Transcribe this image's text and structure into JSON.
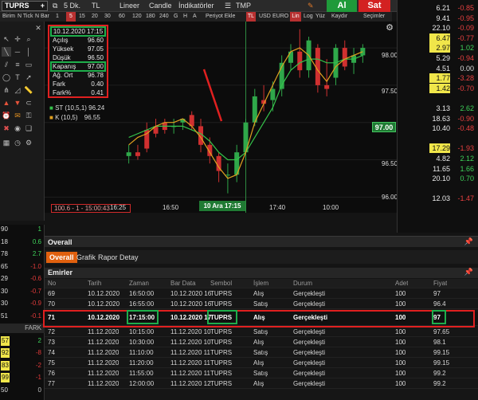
{
  "toolbar": {
    "symbol": "TUPRS",
    "period": "5 Dk.",
    "tl": "TL",
    "scale": "Lineer",
    "chart_type": "Candle",
    "indicators": "İndikatörler",
    "template": "TMP",
    "buy_label": "Al",
    "sell_label": "Sat"
  },
  "toolbar2": {
    "items": [
      "Birim",
      "N Tick",
      "N Bar",
      "1",
      "5",
      "15",
      "20",
      "30",
      "60",
      "120",
      "180",
      "240",
      "G",
      "H",
      "A",
      "Periyot Ekle",
      "TL",
      "USD",
      "EURO",
      "Lin",
      "Log",
      "Yüz",
      "Kaydır",
      "Seçimler"
    ]
  },
  "info": {
    "datetime": "10.12.2020 17:15",
    "rows": [
      {
        "label": "Açılış",
        "value": "96.60"
      },
      {
        "label": "Yüksek",
        "value": "97.05"
      },
      {
        "label": "Düşük",
        "value": "96.50"
      },
      {
        "label": "Kapanış",
        "value": "97.00"
      },
      {
        "label": "Ağ. Ort",
        "value": "96.78"
      },
      {
        "label": "Fark",
        "value": "0.40"
      },
      {
        "label": "Fark%",
        "value": "0.41"
      }
    ]
  },
  "legend": {
    "st": "ST (10,5,1) 96.24",
    "k": "K (10,5)",
    "k_value": "96.55"
  },
  "chart_axis": {
    "prices": [
      "98.00",
      "97.50",
      "97.00",
      "96.50",
      "96.00"
    ],
    "current_price": "97.00",
    "times": [
      "16:25",
      "16:50",
      "10 Ara 17:15",
      "17:40",
      "10:00"
    ],
    "bottom_left": "100.6 - 1 - 15:00:43"
  },
  "chart_data": {
    "type": "candlestick",
    "ylim": [
      95.95,
      98.3
    ],
    "candles": [
      {
        "o": 96.55,
        "h": 96.7,
        "l": 96.45,
        "c": 96.6
      },
      {
        "o": 96.6,
        "h": 96.7,
        "l": 96.5,
        "c": 96.55
      },
      {
        "o": 96.9,
        "h": 97.0,
        "l": 96.6,
        "c": 96.65
      },
      {
        "o": 96.95,
        "h": 97.05,
        "l": 96.8,
        "c": 96.85
      },
      {
        "o": 97.0,
        "h": 97.05,
        "l": 96.85,
        "c": 96.9
      },
      {
        "o": 96.95,
        "h": 97.05,
        "l": 96.85,
        "c": 96.95
      },
      {
        "o": 97.0,
        "h": 97.05,
        "l": 96.9,
        "c": 97.05
      },
      {
        "o": 97.1,
        "h": 97.15,
        "l": 96.9,
        "c": 96.95
      },
      {
        "o": 96.95,
        "h": 97.05,
        "l": 96.6,
        "c": 96.7
      },
      {
        "o": 96.7,
        "h": 96.8,
        "l": 96.45,
        "c": 96.55
      },
      {
        "o": 96.55,
        "h": 96.6,
        "l": 96.2,
        "c": 96.35
      },
      {
        "o": 96.3,
        "h": 96.45,
        "l": 96.05,
        "c": 96.3
      },
      {
        "o": 96.3,
        "h": 96.7,
        "l": 96.2,
        "c": 96.6
      },
      {
        "o": 96.6,
        "h": 97.05,
        "l": 96.5,
        "c": 97.0
      },
      {
        "o": 97.0,
        "h": 97.45,
        "l": 96.95,
        "c": 97.35
      },
      {
        "o": 97.3,
        "h": 97.5,
        "l": 97.15,
        "c": 97.25
      },
      {
        "o": 97.3,
        "h": 97.55,
        "l": 97.15,
        "c": 97.45
      },
      {
        "o": 97.45,
        "h": 97.9,
        "l": 97.35,
        "c": 97.8
      },
      {
        "o": 97.8,
        "h": 98.05,
        "l": 97.7,
        "c": 97.95
      },
      {
        "o": 97.95,
        "h": 98.25,
        "l": 97.6,
        "c": 97.7
      },
      {
        "o": 97.7,
        "h": 98.15,
        "l": 97.6,
        "c": 98.1
      },
      {
        "o": 98.0,
        "h": 98.05,
        "l": 97.4,
        "c": 97.5
      },
      {
        "o": 97.5,
        "h": 97.85,
        "l": 97.35,
        "c": 97.45
      },
      {
        "o": 97.6,
        "h": 98.05,
        "l": 97.5,
        "c": 98.0
      },
      {
        "o": 98.0,
        "h": 98.1,
        "l": 97.7,
        "c": 97.75
      },
      {
        "o": 97.8,
        "h": 98.0,
        "l": 97.65,
        "c": 97.9
      },
      {
        "o": 97.9,
        "h": 98.05,
        "l": 97.8,
        "c": 98.0
      }
    ],
    "st_line": [
      96.8,
      96.85,
      96.9,
      96.95,
      96.95,
      96.95,
      96.95,
      96.9,
      96.85,
      96.75,
      96.6,
      96.5,
      96.5,
      96.6,
      96.8,
      97.0,
      97.2,
      97.5,
      97.7,
      97.8,
      97.85,
      97.85,
      97.8,
      97.8,
      97.85,
      97.85,
      97.9
    ],
    "k_line": [
      96.7,
      96.8,
      96.85,
      96.95,
      97.0,
      97.0,
      97.05,
      96.95,
      96.8,
      96.6,
      96.4,
      96.25,
      96.3,
      96.6,
      97.0,
      97.25,
      97.5,
      97.75,
      97.95,
      98.0,
      97.9,
      97.7,
      97.55,
      97.75,
      97.85,
      97.9,
      97.95
    ]
  },
  "watchlist": [
    {
      "price": "6.21",
      "change": "-0.85",
      "bg": ""
    },
    {
      "price": "9.41",
      "change": "-0.95",
      "bg": ""
    },
    {
      "price": "22.10",
      "change": "-0.09",
      "bg": ""
    },
    {
      "price": "6.47",
      "change": "-0.77",
      "bg": "#f0e64a"
    },
    {
      "price": "2.97",
      "change": "1.02",
      "bg": "#f0e64a"
    },
    {
      "price": "5.29",
      "change": "-0.94",
      "bg": ""
    },
    {
      "price": "4.51",
      "change": "0.00",
      "bg": ""
    },
    {
      "price": "1.77",
      "change": "-3.28",
      "bg": "#f0e64a"
    },
    {
      "price": "1.42",
      "change": "-0.70",
      "bg": "#f0e64a"
    },
    {
      "price": "",
      "change": "",
      "bg": ""
    },
    {
      "price": "3.13",
      "change": "2.62",
      "bg": ""
    },
    {
      "price": "18.63",
      "change": "-0.90",
      "bg": ""
    },
    {
      "price": "10.40",
      "change": "-0.48",
      "bg": ""
    },
    {
      "price": "",
      "change": "",
      "bg": ""
    },
    {
      "price": "17.29",
      "change": "-1.93",
      "bg": "#f0e64a"
    },
    {
      "price": "4.82",
      "change": "2.12",
      "bg": ""
    },
    {
      "price": "11.65",
      "change": "1.66",
      "bg": ""
    },
    {
      "price": "20.10",
      "change": "0.70",
      "bg": ""
    },
    {
      "price": "",
      "change": "",
      "bg": ""
    },
    {
      "price": "12.03",
      "change": "-1.47",
      "bg": ""
    }
  ],
  "left_column": [
    {
      "a": "90",
      "b": "1",
      "b_color": "#3fd35a"
    },
    {
      "a": "18",
      "b": "0.6",
      "b_color": "#3fd35a"
    },
    {
      "a": "78",
      "b": "2.7",
      "b_color": "#3fd35a"
    },
    {
      "a": "65",
      "b": "-1.0",
      "b_color": "#e03a3a"
    },
    {
      "a": "29",
      "b": "-0.6",
      "b_color": "#e03a3a"
    },
    {
      "a": "30",
      "b": "-0.7",
      "b_color": "#e03a3a"
    },
    {
      "a": "30",
      "b": "-0.9",
      "b_color": "#e03a3a"
    },
    {
      "a": "51",
      "b": "-0.1",
      "b_color": "#e03a3a"
    },
    {
      "a": "",
      "b": "FARK",
      "b_color": "#bbbbbb"
    },
    {
      "a": "57",
      "b": "2",
      "b_color": "#3fd35a"
    },
    {
      "a": "92",
      "b": "-8",
      "b_color": "#e03a3a"
    },
    {
      "a": "83",
      "b": "-2",
      "b_color": "#e03a3a"
    },
    {
      "a": "99",
      "b": "-1",
      "b_color": "#e03a3a"
    },
    {
      "a": "50",
      "b": "0",
      "b_color": "#bbbbbb"
    }
  ],
  "overall": {
    "title": "Overall",
    "tabs": [
      "Overall",
      "Grafik",
      "Rapor Detay"
    ],
    "emirler": "Emirler",
    "columns": [
      "No",
      "Tarih",
      "Zaman",
      "Bar Data",
      "Sembol",
      "İşlem",
      "Durum",
      "Adet",
      "Fiyat"
    ],
    "rows": [
      [
        "69",
        "10.12.2020",
        "16:50:00",
        "10.12.2020 16",
        "TUPRS",
        "Alış",
        "Gerçekleşti",
        "100",
        "97"
      ],
      [
        "70",
        "10.12.2020",
        "16:55:00",
        "10.12.2020 16",
        "TUPRS",
        "Satış",
        "Gerçekleşti",
        "100",
        "96.4"
      ],
      [
        "71",
        "10.12.2020",
        "17:15:00",
        "10.12.2020 17",
        "TUPRS",
        "Alış",
        "Gerçekleşti",
        "100",
        "97"
      ],
      [
        "72",
        "11.12.2020",
        "10:15:00",
        "11.12.2020 10",
        "TUPRS",
        "Satış",
        "Gerçekleşti",
        "100",
        "97.65"
      ],
      [
        "73",
        "11.12.2020",
        "10:30:00",
        "11.12.2020 10",
        "TUPRS",
        "Alış",
        "Gerçekleşti",
        "100",
        "98.1"
      ],
      [
        "74",
        "11.12.2020",
        "11:10:00",
        "11.12.2020 11",
        "TUPRS",
        "Satış",
        "Gerçekleşti",
        "100",
        "99.15"
      ],
      [
        "75",
        "11.12.2020",
        "11:20:00",
        "11.12.2020 11",
        "TUPRS",
        "Alış",
        "Gerçekleşti",
        "100",
        "99.15"
      ],
      [
        "76",
        "11.12.2020",
        "11:55:00",
        "11.12.2020 11",
        "TUPRS",
        "Satış",
        "Gerçekleşti",
        "100",
        "99.2"
      ],
      [
        "77",
        "11.12.2020",
        "12:00:00",
        "11.12.2020 12",
        "TUPRS",
        "Alış",
        "Gerçekleşti",
        "100",
        "99.2"
      ]
    ]
  }
}
